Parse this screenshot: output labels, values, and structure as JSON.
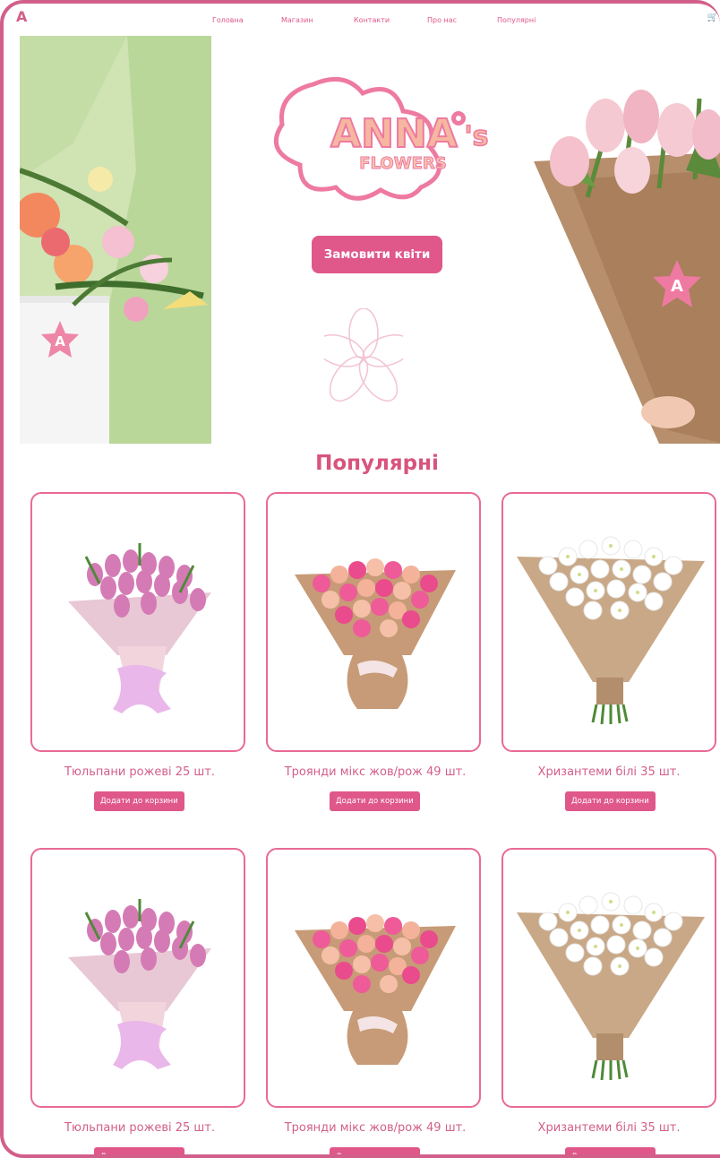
{
  "nav": {
    "logo_letter": "A",
    "links": [
      "Головна",
      "Магазин",
      "Контакти",
      "Про нас",
      "Популярні"
    ],
    "cart_icon": "cart-icon"
  },
  "hero": {
    "brand_line1": "ANNA",
    "brand_apostrophe_s": "'s",
    "brand_line2": "FLOWERS",
    "order_button": "Замовити квіти",
    "decor_icon": "flower-outline-icon",
    "left_image": "bouquet-in-white-bag",
    "right_image": "tulips-in-kraft-paper"
  },
  "section": {
    "title": "Популярні"
  },
  "products": [
    {
      "name": "Тюльпани рожеві 25 шт.",
      "button": "Додати до корзини",
      "image": "pink-tulips-bouquet"
    },
    {
      "name": "Троянди мікс жов/рож 49 шт.",
      "button": "Додати до корзини",
      "image": "mixed-roses-bouquet"
    },
    {
      "name": "Хризантеми білі 35 шт.",
      "button": "Додати до корзини",
      "image": "white-chrysanthemums-bouquet"
    },
    {
      "name": "Тюльпани рожеві 25 шт.",
      "button": "Додати до корзини",
      "image": "pink-tulips-bouquet"
    },
    {
      "name": "Троянди мікс жов/рож 49 шт.",
      "button": "Додати до корзини",
      "image": "mixed-roses-bouquet"
    },
    {
      "name": "Хризантеми білі 35 шт.",
      "button": "Додати до корзини",
      "image": "white-chrysanthemums-bouquet"
    }
  ],
  "colors": {
    "accent": "#e0578a",
    "frame": "#d25f8a",
    "card_border": "#e96a95"
  }
}
